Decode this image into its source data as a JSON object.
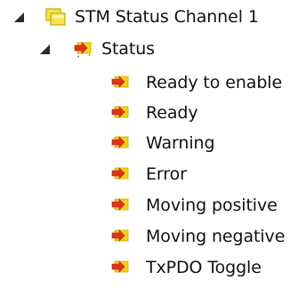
{
  "tree": {
    "root": {
      "label": "STM Status Channel 1",
      "icon": "channel-folder-icon",
      "expanded": true
    },
    "group": {
      "label": "Status",
      "icon": "input-variable-icon",
      "expanded": true
    },
    "items": [
      {
        "label": "Ready to enable",
        "icon": "input-variable-icon"
      },
      {
        "label": "Ready",
        "icon": "input-variable-icon"
      },
      {
        "label": "Warning",
        "icon": "input-variable-icon"
      },
      {
        "label": "Error",
        "icon": "input-variable-icon"
      },
      {
        "label": "Moving positive",
        "icon": "input-variable-icon"
      },
      {
        "label": "Moving negative",
        "icon": "input-variable-icon"
      },
      {
        "label": "TxPDO Toggle",
        "icon": "input-variable-icon"
      }
    ]
  },
  "colors": {
    "folder_fill": "#f7e24a",
    "folder_stroke": "#c9a800",
    "var_yellow": "#f5d21e",
    "var_red": "#e0341c",
    "expander": "#2a2a2a"
  }
}
